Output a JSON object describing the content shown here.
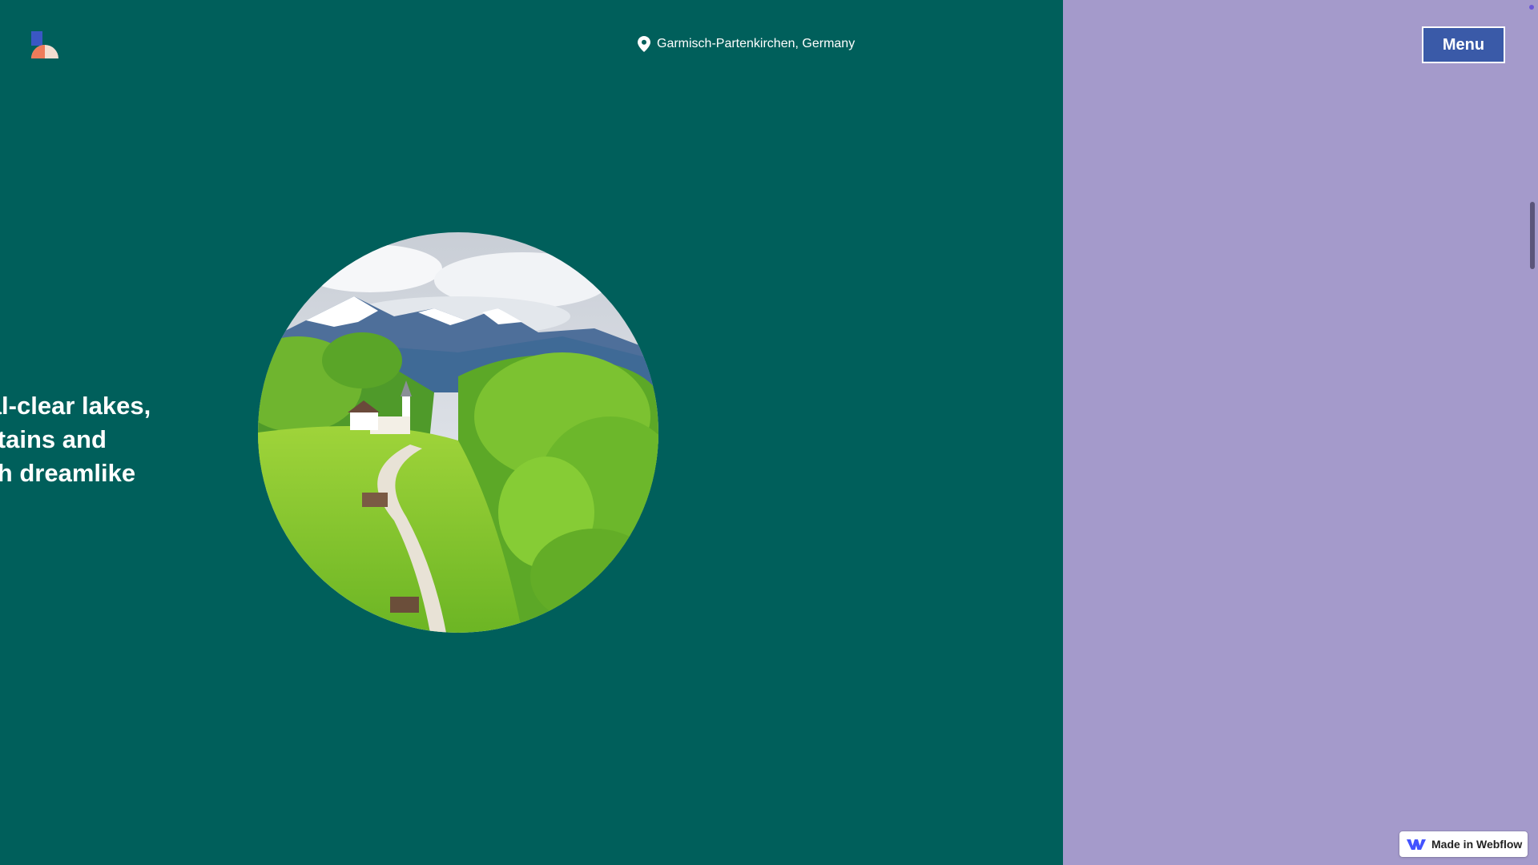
{
  "header": {
    "location_text": "Garmisch-Partenkirchen, Germany",
    "menu_label": "Menu"
  },
  "hero": {
    "lines": [
      "ystal-clear lakes,",
      "ountains and",
      "ough dreamlike"
    ]
  },
  "badge": {
    "label": "Made in Webflow"
  },
  "colors": {
    "teal": "#005f5b",
    "lavender": "#a49acb",
    "menu_button": "#3a5aa8"
  },
  "icons": {
    "logo": "site-logo",
    "location": "map-pin-icon",
    "webflow": "webflow-logo-icon"
  }
}
